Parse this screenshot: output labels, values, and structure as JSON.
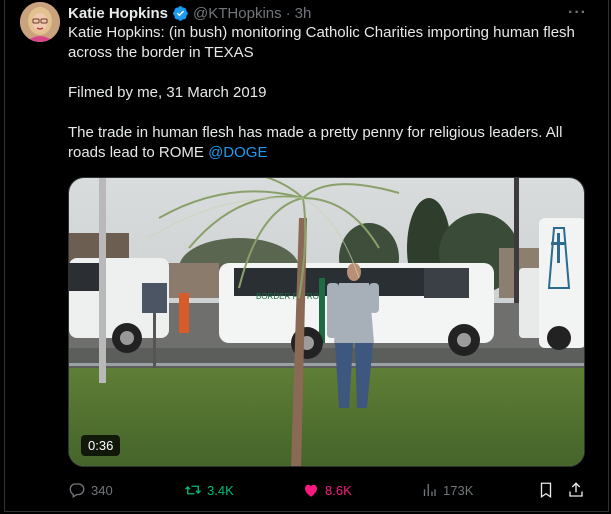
{
  "tweet": {
    "author_name": "Katie Hopkins",
    "handle": "@KTHopkins",
    "separator": "·",
    "time": "3h",
    "more_label": "···",
    "line1": "Katie Hopkins: (in bush) monitoring Catholic Charities importing human flesh across the border in TEXAS",
    "line2": "Filmed by me, 31 March 2019",
    "line3": "The trade in human flesh has made a pretty penny for religious leaders. All roads lead to ROME",
    "mention": "@DOGE"
  },
  "media": {
    "duration": "0:36",
    "van_logo_text": "BORDER PATROL"
  },
  "actions": {
    "replies": "340",
    "reposts": "3.4K",
    "likes": "8.6K",
    "views": "173K"
  },
  "colors": {
    "background": "#000000",
    "text": "#e7e9ea",
    "muted": "#71767b",
    "link": "#1d9bf0",
    "repost": "#00ba7c",
    "like": "#f91880"
  }
}
